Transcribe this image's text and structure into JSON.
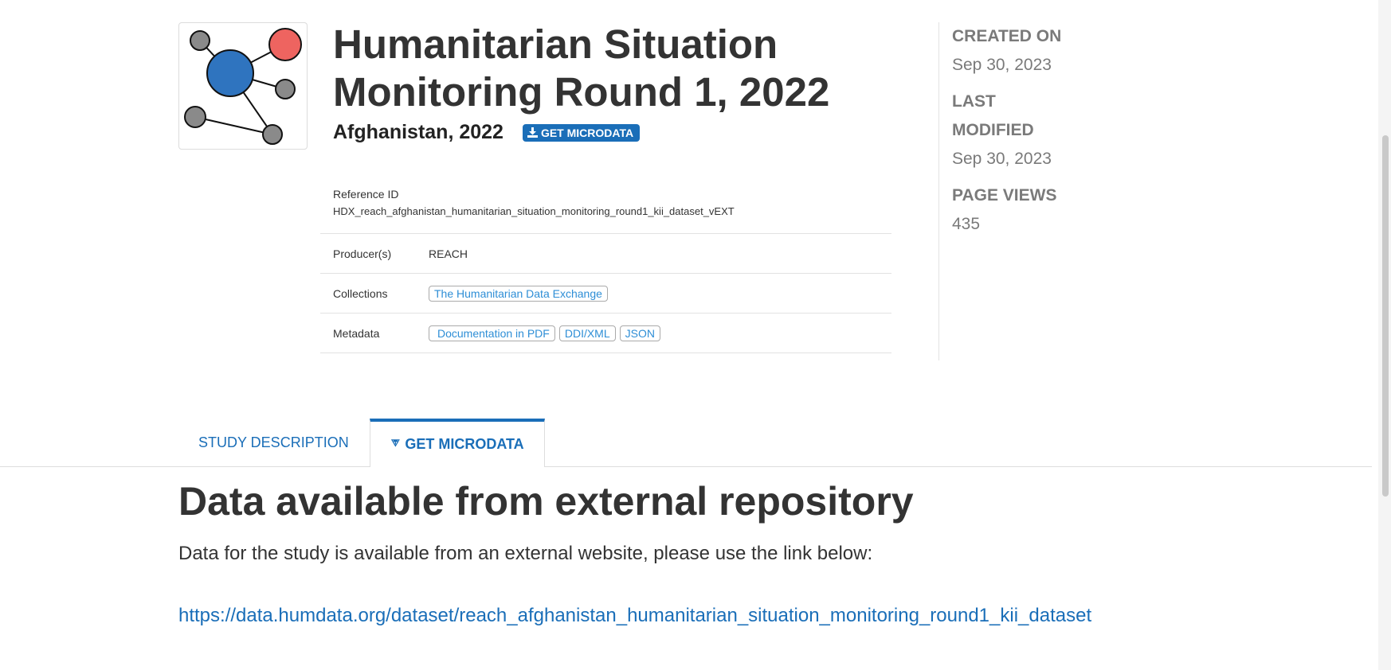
{
  "study": {
    "title": "Humanitarian Situation Monitoring Round 1, 2022",
    "subtitle": "Afghanistan, 2022",
    "get_microdata_badge": "GET MICRODATA",
    "reference_id_label": "Reference ID",
    "reference_id_value": "HDX_reach_afghanistan_humanitarian_situation_monitoring_round1_kii_dataset_vEXT",
    "producers_label": "Producer(s)",
    "producers_value": "REACH",
    "collections_label": "Collections",
    "collections": [
      "The Humanitarian Data Exchange"
    ],
    "metadata_label": "Metadata",
    "metadata_links": [
      "Documentation in PDF",
      "DDI/XML",
      "JSON"
    ]
  },
  "sidebar": {
    "created_label": "CREATED ON",
    "created_value": "Sep 30, 2023",
    "modified_label_line1": "LAST",
    "modified_label_line2": "MODIFIED",
    "modified_value": "Sep 30, 2023",
    "views_label": "PAGE VIEWS",
    "views_value": "435"
  },
  "tabs": [
    {
      "label": "STUDY DESCRIPTION",
      "active": false
    },
    {
      "label": "GET MICRODATA",
      "active": true
    }
  ],
  "content": {
    "heading": "Data available from external repository",
    "paragraph": "Data for the study is available from an external website, please use the link below:",
    "link": "https://data.humdata.org/dataset/reach_afghanistan_humanitarian_situation_monitoring_round1_kii_dataset"
  },
  "colors": {
    "accent": "#1a6eb8",
    "pill_link": "#2e8ed6",
    "node_blue": "#2f74bf",
    "node_red": "#ee6460",
    "node_gray": "#8a8a8a",
    "muted_text": "#7a7a7a"
  },
  "icons": {
    "thumbnail": "network-graph-icon",
    "download": "download-icon",
    "tab_micro": "circle-arrow-icon"
  }
}
